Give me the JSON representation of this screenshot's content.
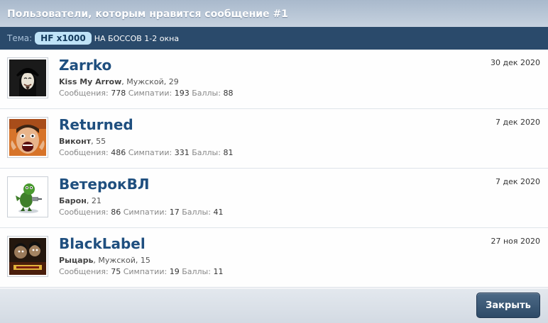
{
  "dialog": {
    "title": "Пользователи, которым нравится сообщение #1",
    "topic_label": "Тема:",
    "topic_prefix": "HF x1000",
    "topic_title": "НА БОССОВ 1-2 окна"
  },
  "stat_labels": {
    "messages": "Сообщения:",
    "likes": "Симпатии:",
    "points": "Баллы:"
  },
  "users": [
    {
      "name": "Zarrko",
      "title": "Kiss My Arrow",
      "details": ", Мужской, 29",
      "messages": "778",
      "likes": "193",
      "points": "88",
      "date": "30 дек 2020",
      "avatar_icon": "masked-face-avatar-icon"
    },
    {
      "name": "Returned",
      "title": "Виконт",
      "details": ", 55",
      "messages": "486",
      "likes": "331",
      "points": "81",
      "date": "7 дек 2020",
      "avatar_icon": "screaming-face-avatar-icon"
    },
    {
      "name": "ВетерокВЛ",
      "title": "Барон",
      "details": ", 21",
      "messages": "86",
      "likes": "17",
      "points": "41",
      "date": "7 дек 2020",
      "avatar_icon": "green-creature-avatar-icon"
    },
    {
      "name": "BlackLabel",
      "title": "Рыцарь",
      "details": ", Мужской, 15",
      "messages": "75",
      "likes": "19",
      "points": "11",
      "date": "27 ноя 2020",
      "avatar_icon": "poster-avatar-icon"
    }
  ],
  "footer": {
    "close_label": "Закрыть"
  },
  "colors": {
    "title_bar": "#b3c2d3",
    "topic_bar": "#2a4a6b",
    "username": "#1f4f7f",
    "button": "#3b5876"
  }
}
